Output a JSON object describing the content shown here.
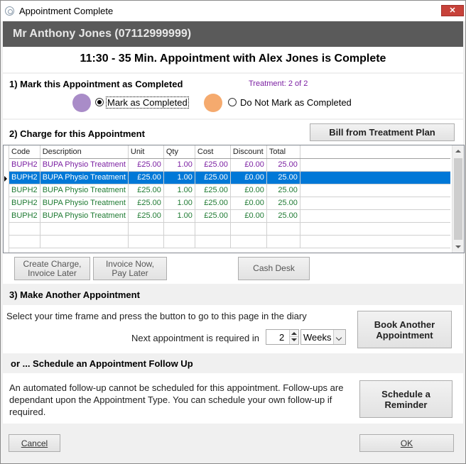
{
  "window": {
    "title": "Appointment Complete",
    "close_glyph": "✕"
  },
  "patient": {
    "name": "Mr Anthony Jones (07112999999)"
  },
  "headline": "11:30 - 35 Min. Appointment with Alex Jones is Complete",
  "section1": {
    "heading": "1) Mark this Appointment as Completed",
    "treatment": "Treatment: 2 of 2",
    "options": [
      {
        "label": "Mark as Completed",
        "selected": true,
        "color": "#a98cc8"
      },
      {
        "label": "Do Not Mark as Completed",
        "selected": false,
        "color": "#f5aa6e"
      }
    ]
  },
  "section2": {
    "heading": "2) Charge for this Appointment",
    "bill_button": "Bill from Treatment Plan",
    "columns": [
      "Code",
      "Description",
      "Unit",
      "Qty",
      "Cost",
      "Discount",
      "Total"
    ],
    "rows": [
      {
        "cells": [
          "BUPH2",
          "BUPA Physio Treatment",
          "£25.00",
          "1.00",
          "£25.00",
          "£0.00",
          "25.00"
        ],
        "style": "purple"
      },
      {
        "cells": [
          "BUPH2",
          "BUPA Physio Treatment",
          "£25.00",
          "1.00",
          "£25.00",
          "£0.00",
          "25.00"
        ],
        "style": "selected"
      },
      {
        "cells": [
          "BUPH2",
          "BUPA Physio Treatment",
          "£25.00",
          "1.00",
          "£25.00",
          "£0.00",
          "25.00"
        ],
        "style": "green"
      },
      {
        "cells": [
          "BUPH2",
          "BUPA Physio Treatment",
          "£25.00",
          "1.00",
          "£25.00",
          "£0.00",
          "25.00"
        ],
        "style": "green"
      },
      {
        "cells": [
          "BUPH2",
          "BUPA Physio Treatment",
          "£25.00",
          "1.00",
          "£25.00",
          "£0.00",
          "25.00"
        ],
        "style": "green"
      }
    ],
    "empty_rows": 2,
    "buttons": {
      "create_charge": "Create Charge, Invoice Later",
      "invoice_now": "Invoice Now, Pay Later",
      "cash_desk": "Cash Desk"
    }
  },
  "section3": {
    "heading": "3) Make Another Appointment",
    "instruction": "Select your time frame and press the button to go to this page in the diary",
    "next_label": "Next appointment is required in",
    "next_value": "2",
    "unit_value": "Weeks",
    "book_button": "Book Another Appointment"
  },
  "section4": {
    "heading": "or ... Schedule an Appointment Follow Up",
    "text": "An automated follow-up cannot be scheduled for this appointment. Follow-ups are dependant upon the Appointment Type. You can schedule your own follow-up if required.",
    "reminder_button": "Schedule a Reminder"
  },
  "footer": {
    "cancel": "Cancel",
    "ok": "OK"
  }
}
